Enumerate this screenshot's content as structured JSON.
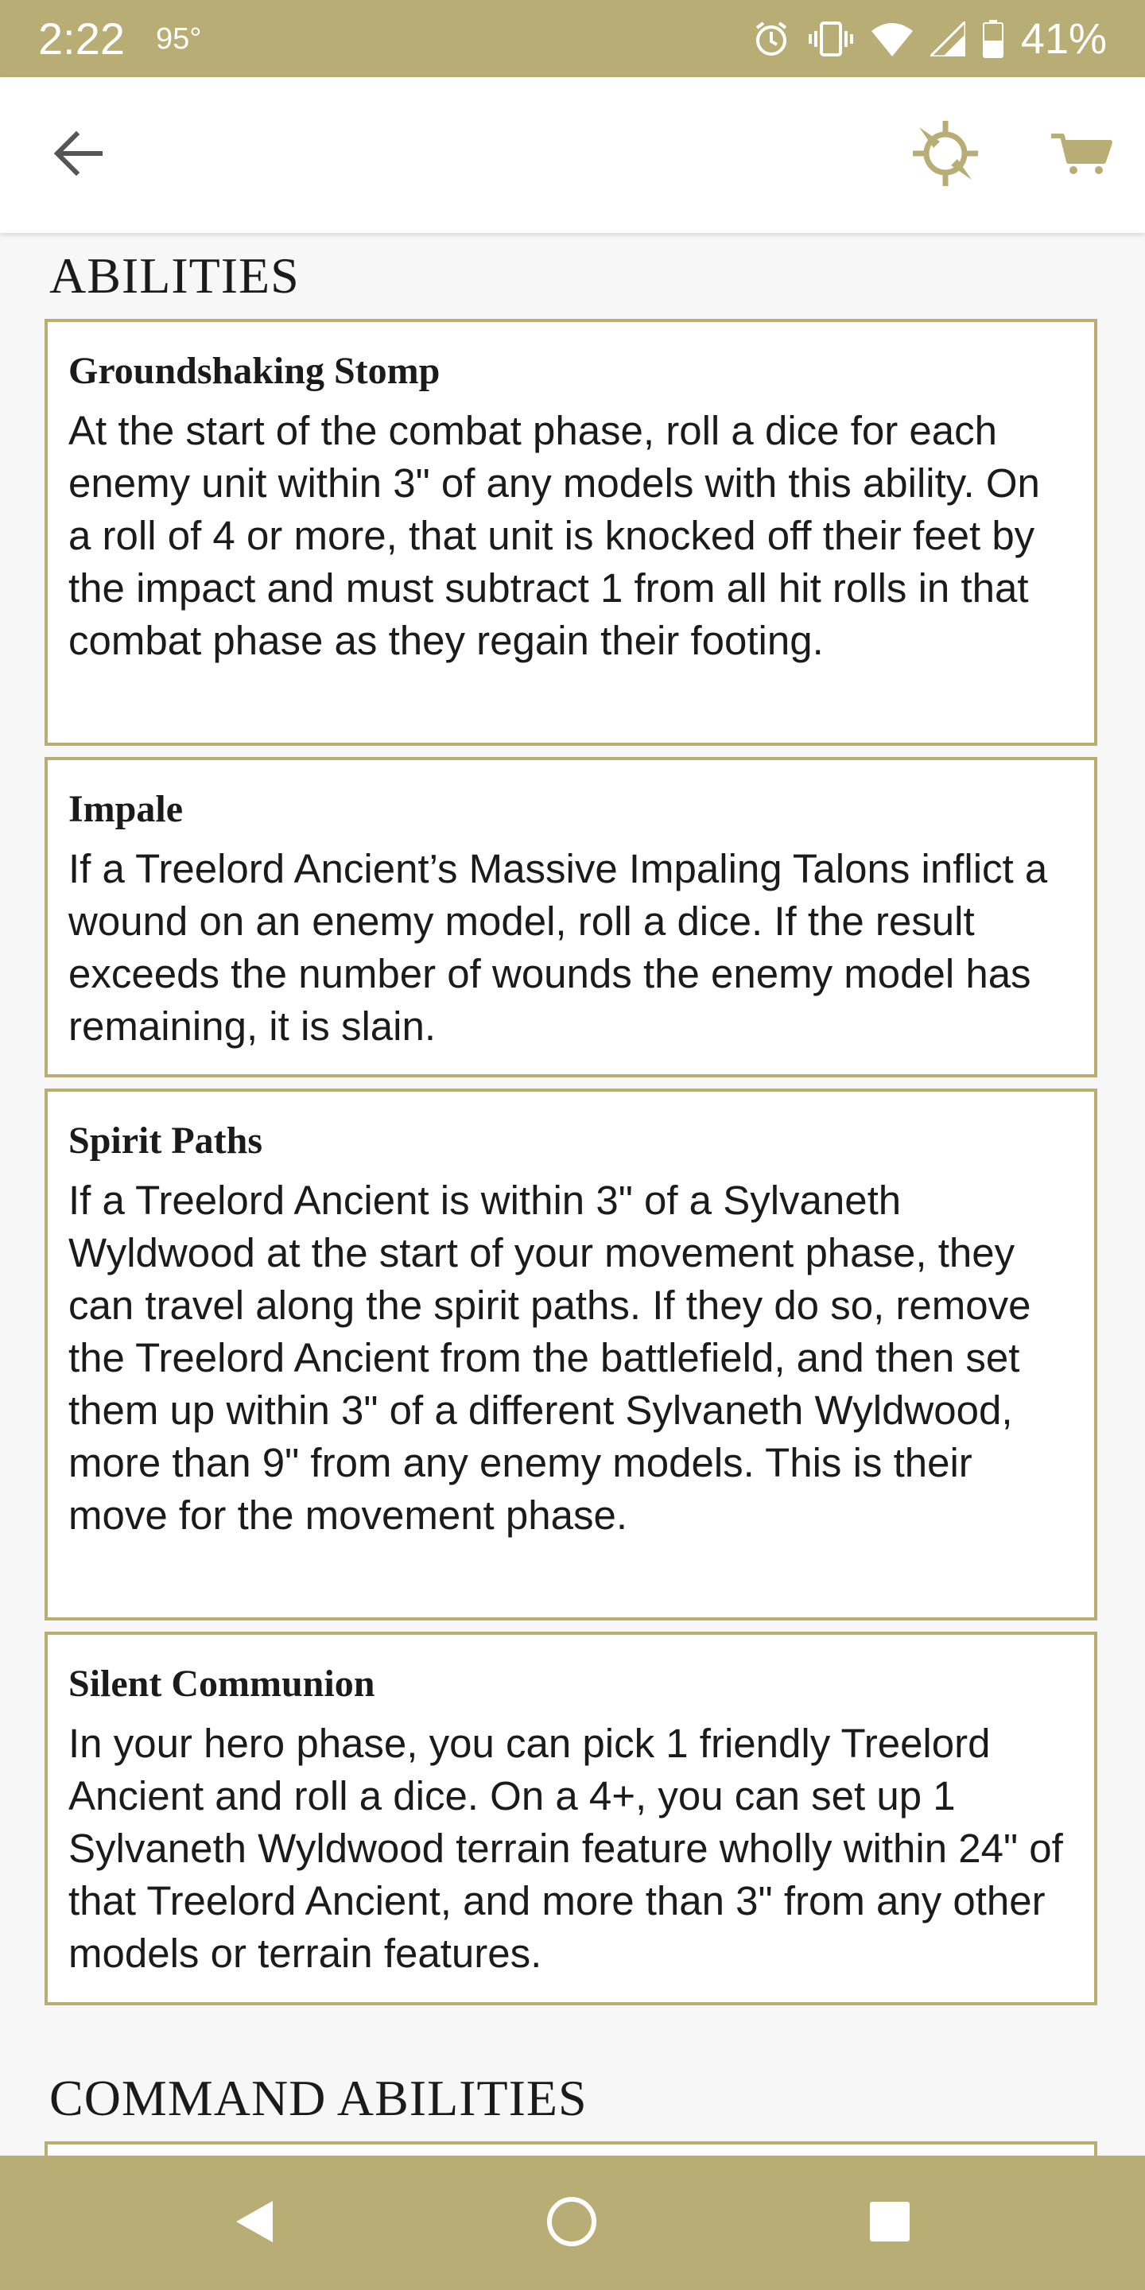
{
  "status_bar": {
    "time": "2:22",
    "temperature": "95°",
    "battery_percent": "41%",
    "icons": [
      "alarm-icon",
      "vibrate-icon",
      "wifi-icon",
      "signal-icon",
      "battery-icon"
    ]
  },
  "app_bar": {
    "icons": [
      "back-arrow-icon",
      "compass-icon",
      "cart-icon"
    ]
  },
  "abilities": {
    "title": "ABILITIES",
    "items": [
      {
        "name": "Groundshaking Stomp",
        "text": "At the start of the combat phase, roll a dice for each enemy unit within 3\" of any models with this ability. On a roll of 4 or more, that unit is knocked off their feet by the impact and must subtract 1 from all hit rolls in that combat phase as they regain their footing."
      },
      {
        "name": "Impale",
        "text": "If a Treelord Ancient’s Massive Impaling Talons inflict a wound on an enemy model, roll a dice. If the result exceeds the number of wounds the enemy model has remaining, it is slain."
      },
      {
        "name": "Spirit Paths",
        "text": "If a Treelord Ancient is within 3\" of a Sylvaneth Wyldwood at the start of your movement phase, they can travel along the spirit paths. If they do so, remove the Treelord Ancient from the battlefield, and then set them up within 3\" of a different Sylvaneth Wyldwood, more than 9\" from any enemy models. This is their move for the movement phase."
      },
      {
        "name": "Silent Communion",
        "text": "In your hero phase, you can pick 1 friendly Treelord Ancient and roll a dice. On a 4+, you can set up 1 Sylvaneth Wyldwood terrain feature wholly within 24\" of that Treelord Ancient, and more than 3\" from any other models or terrain features."
      }
    ]
  },
  "command_abilities": {
    "title": "COMMAND ABILITIES"
  },
  "nav_bar": {
    "icons": [
      "nav-back-icon",
      "nav-home-icon",
      "nav-recents-icon"
    ]
  },
  "colors": {
    "accent": "#b8ad74",
    "card_border": "#b9ad72",
    "background": "#f7f7f7"
  }
}
